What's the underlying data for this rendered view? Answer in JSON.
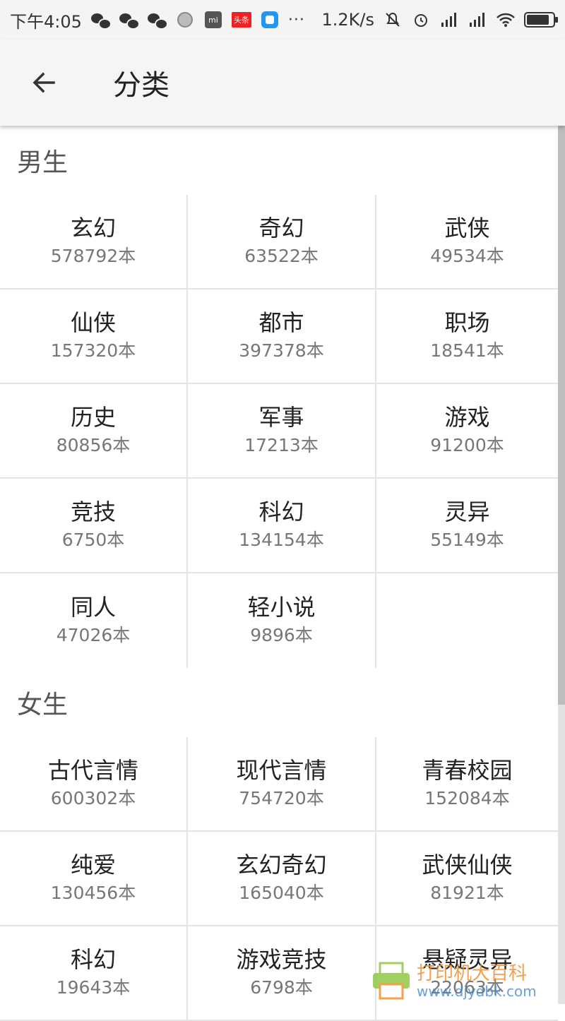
{
  "status_bar": {
    "time": "下午4:05",
    "toutiao_label": "头条",
    "mi_label": "mi",
    "more": "···",
    "speed": "1.2K/s",
    "battery_level": 0.85
  },
  "app_bar": {
    "title": "分类"
  },
  "sections": [
    {
      "title": "男生",
      "items": [
        {
          "name": "玄幻",
          "count": "578792本"
        },
        {
          "name": "奇幻",
          "count": "63522本"
        },
        {
          "name": "武侠",
          "count": "49534本"
        },
        {
          "name": "仙侠",
          "count": "157320本"
        },
        {
          "name": "都市",
          "count": "397378本"
        },
        {
          "name": "职场",
          "count": "18541本"
        },
        {
          "name": "历史",
          "count": "80856本"
        },
        {
          "name": "军事",
          "count": "17213本"
        },
        {
          "name": "游戏",
          "count": "91200本"
        },
        {
          "name": "竞技",
          "count": "6750本"
        },
        {
          "name": "科幻",
          "count": "134154本"
        },
        {
          "name": "灵异",
          "count": "55149本"
        },
        {
          "name": "同人",
          "count": "47026本"
        },
        {
          "name": "轻小说",
          "count": "9896本"
        }
      ]
    },
    {
      "title": "女生",
      "items": [
        {
          "name": "古代言情",
          "count": "600302本"
        },
        {
          "name": "现代言情",
          "count": "754720本"
        },
        {
          "name": "青春校园",
          "count": "152084本"
        },
        {
          "name": "纯爱",
          "count": "130456本"
        },
        {
          "name": "玄幻奇幻",
          "count": "165040本"
        },
        {
          "name": "武侠仙侠",
          "count": "81921本"
        },
        {
          "name": "科幻",
          "count": "19643本"
        },
        {
          "name": "游戏竞技",
          "count": "6798本"
        },
        {
          "name": "悬疑灵异",
          "count": "22063本"
        }
      ]
    }
  ],
  "watermark": {
    "text": "打印机大百科",
    "url": "www.djydbk.com"
  },
  "colors": {
    "app_bar_bg": "#f5f5f5",
    "divider": "#e4e4e4",
    "count_text": "#777777",
    "section_title": "#555555"
  }
}
